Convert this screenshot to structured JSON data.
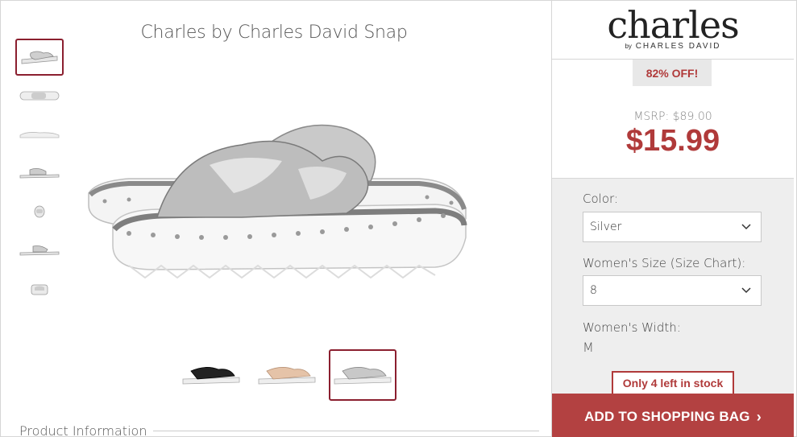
{
  "product": {
    "title": "Charles by Charles David Snap",
    "info_heading": "Product Information"
  },
  "brand": {
    "name": "charles",
    "by": "by",
    "sub": "CHARLES DAVID"
  },
  "pricing": {
    "discount": "82% OFF!",
    "msrp": "MSRP: $89.00",
    "price": "$15.99"
  },
  "options": {
    "color_label": "Color:",
    "color_value": "Silver",
    "size_label": "Women's Size (Size Chart):",
    "size_value": "8",
    "width_label": "Women's Width:",
    "width_value": "M"
  },
  "stock": "Only 4 left in stock",
  "cart_button": "ADD TO SHOPPING BAG",
  "colors": {
    "accent": "#b34141",
    "selected_border": "#8b1f2f"
  }
}
